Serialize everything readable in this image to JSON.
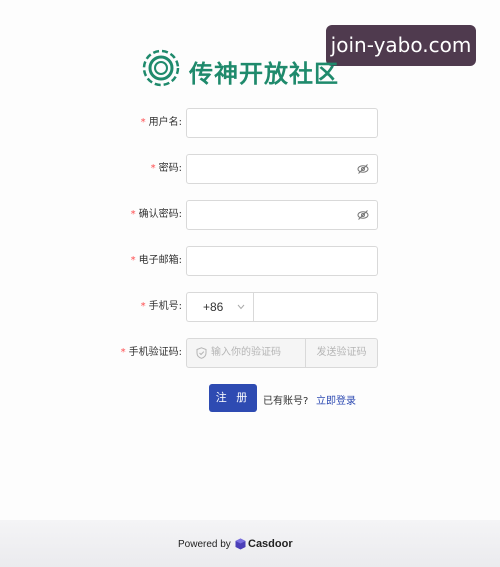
{
  "watermark": "join-yabo.com",
  "site": {
    "title": "传神开放社区",
    "logo_icon": "community-ring-logo",
    "accent": "#1f8a6c"
  },
  "form": {
    "required_mark": "*",
    "fields": {
      "username": {
        "label": "用户名:"
      },
      "password": {
        "label": "密码:",
        "toggle_icon": "eye-slash-icon"
      },
      "confirm_password": {
        "label": "确认密码:",
        "toggle_icon": "eye-slash-icon"
      },
      "email": {
        "label": "电子邮箱:"
      },
      "phone": {
        "label": "手机号:",
        "country_code": "+86"
      },
      "verification": {
        "label": "手机验证码:",
        "placeholder": "输入你的验证码",
        "send_label": "发送验证码"
      }
    },
    "register_label": "注 册",
    "have_account": "已有账号?",
    "login_link": "立即登录",
    "primary_color": "#2e4bb2"
  },
  "footer": {
    "powered_by": "Powered by",
    "brand": "Casdoor"
  }
}
